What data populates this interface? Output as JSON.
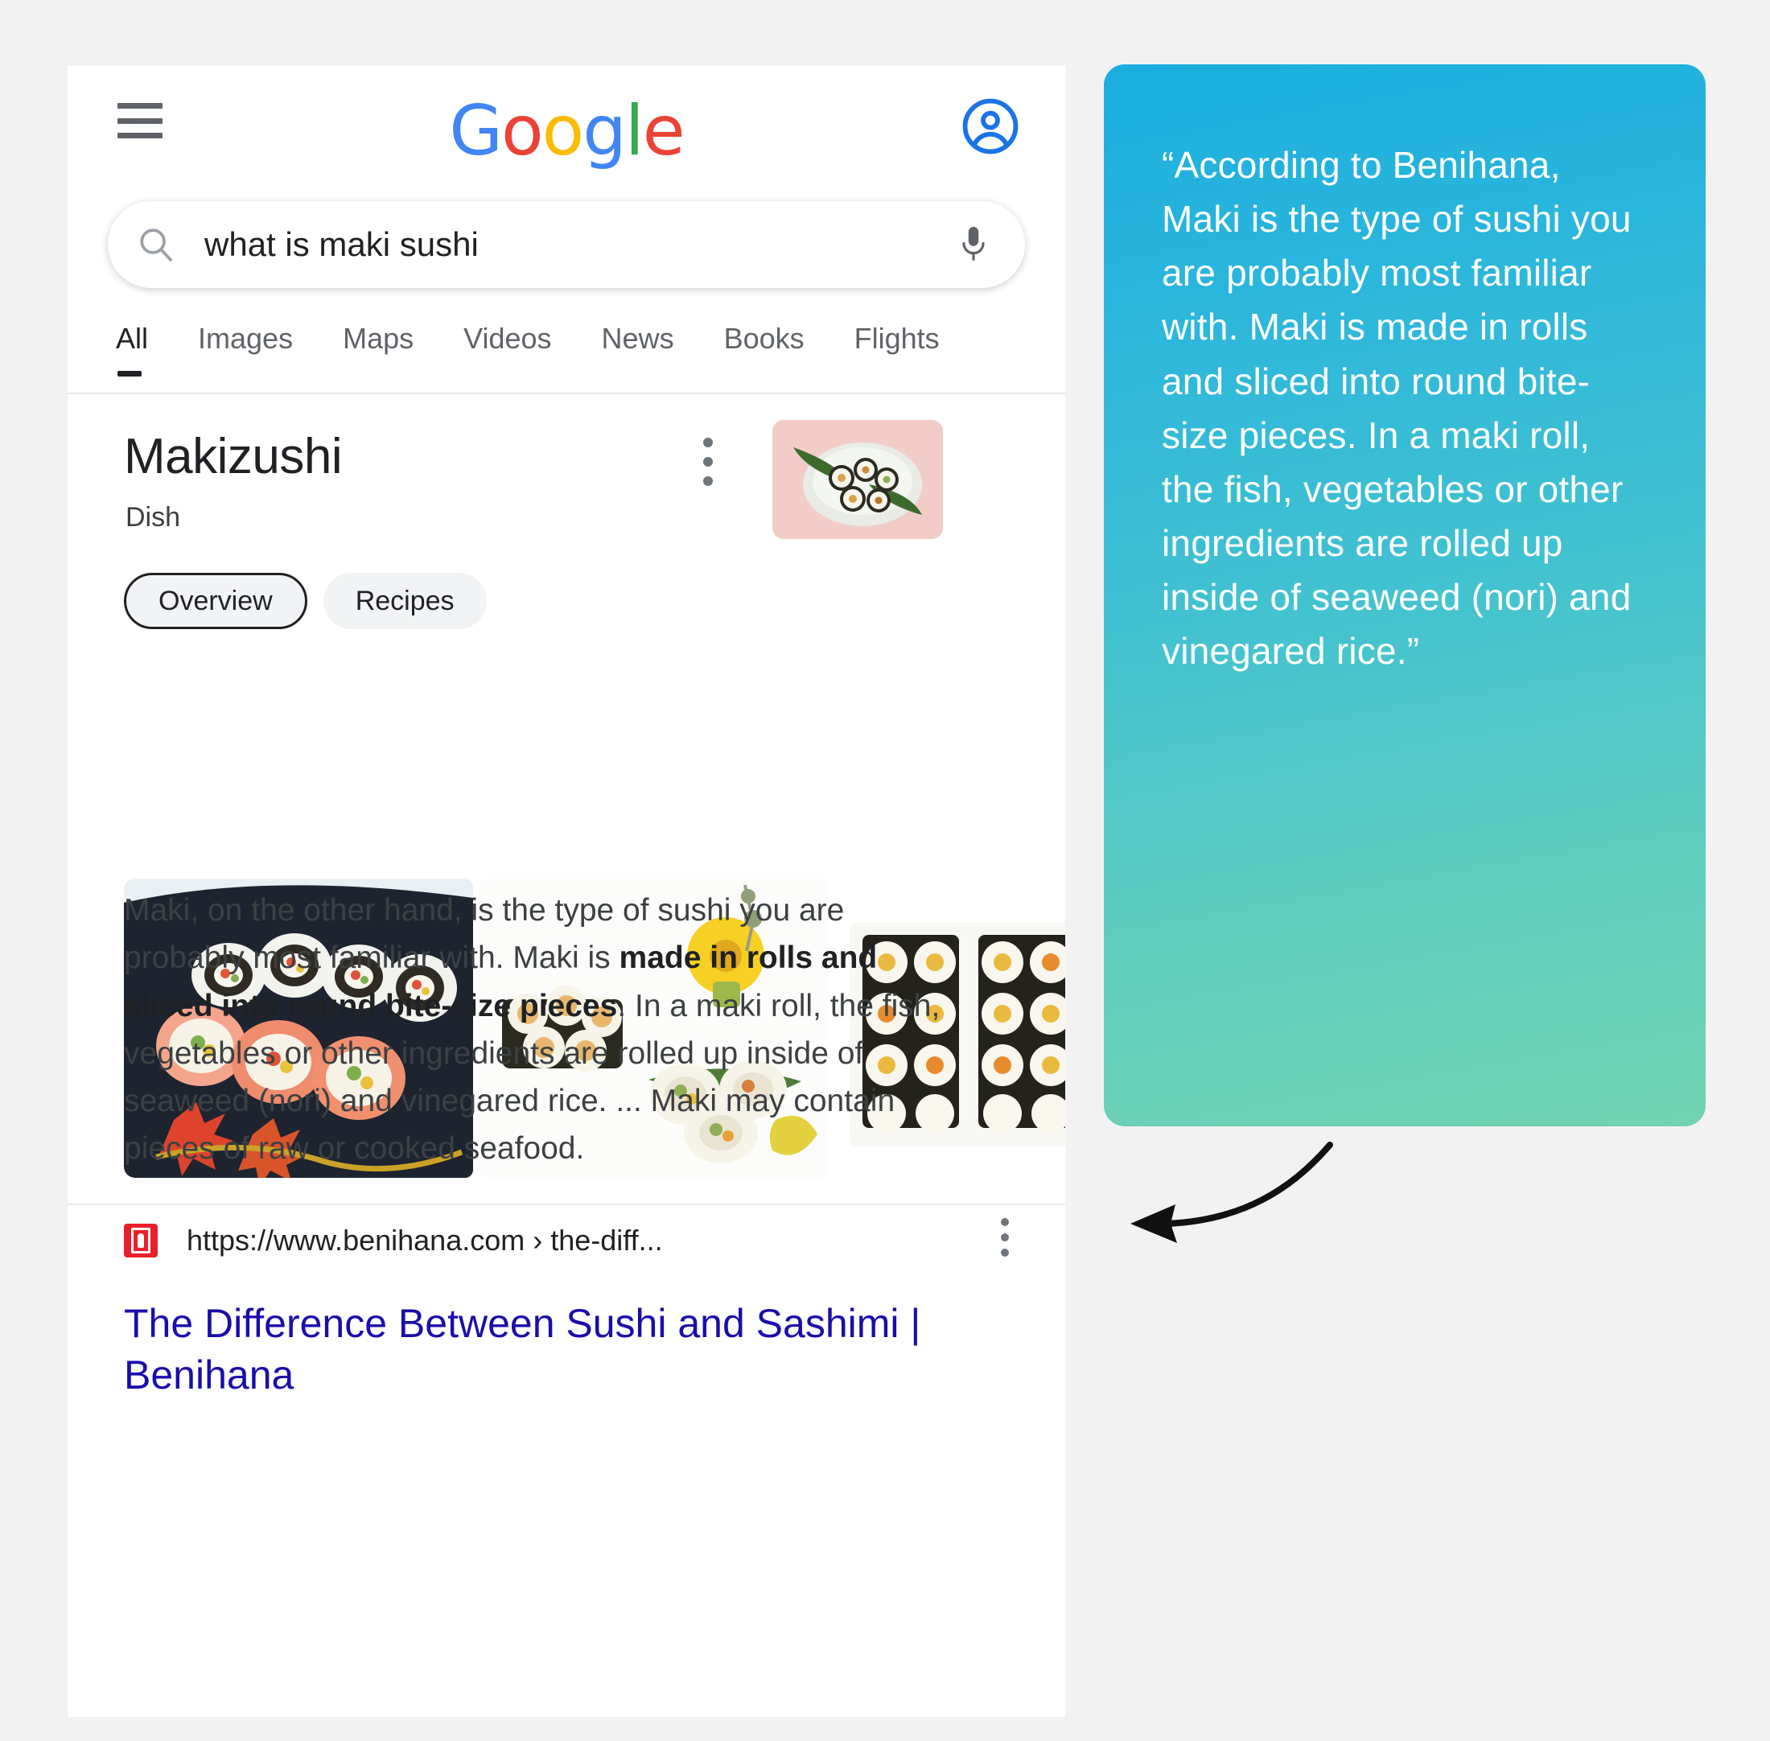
{
  "browser": {
    "header": {
      "menu_icon": "hamburger-menu-icon",
      "logo_letters": [
        "G",
        "o",
        "o",
        "g",
        "l",
        "e"
      ],
      "logo_text": "Google",
      "account_icon": "account-circle-icon"
    },
    "search": {
      "icon": "search-icon",
      "query": "what is maki sushi",
      "placeholder": "Search",
      "mic_icon": "microphone-icon"
    },
    "tabs": [
      {
        "label": "All",
        "active": true
      },
      {
        "label": "Images",
        "active": false
      },
      {
        "label": "Maps",
        "active": false
      },
      {
        "label": "Videos",
        "active": false
      },
      {
        "label": "News",
        "active": false
      },
      {
        "label": "Books",
        "active": false
      },
      {
        "label": "Flights",
        "active": false
      }
    ],
    "knowledge_panel": {
      "title": "Makizushi",
      "subtitle": "Dish",
      "overflow_icon": "more-vert-icon",
      "thumbnail_alt": "maki sushi rolls on a white plate with green leaf",
      "chips": [
        {
          "label": "Overview",
          "selected": true
        },
        {
          "label": "Recipes",
          "selected": false
        }
      ],
      "images": [
        {
          "alt": "assorted maki rolls on a black lacquer plate with maple leaves"
        },
        {
          "alt": "maki rolls on white background with yellow chrysanthemum garnish"
        },
        {
          "alt": "rows of maki rolls with yellow and orange fillings"
        }
      ]
    },
    "result": {
      "snippet_parts": [
        {
          "text": "Maki, on the other hand, is the type of sushi you are probably most familiar with. Maki is ",
          "bold": false
        },
        {
          "text": "made in rolls and sliced into round bite-size pieces",
          "bold": true
        },
        {
          "text": ". In a maki roll, the fish, vegetables or other ingredients are rolled up inside of seaweed (nori) and vinegared rice. ... Maki may contain pieces of raw or cooked seafood.",
          "bold": false
        }
      ],
      "favicon_name": "benihana-favicon",
      "url": "https://www.benihana.com › the-diff...",
      "overflow_icon": "more-vert-icon",
      "title": "The Difference Between Sushi and Sashimi | Benihana"
    }
  },
  "callout": {
    "quote": "“According to Benihana, Maki is the type of sushi you are probably most familiar with. Maki is made in rolls and sliced into round bite-size pieces. In a maki roll, the fish, vegetables or other ingredients are rolled up inside of seaweed (nori) and vinegared rice.”",
    "gradient_start": "#1aaede",
    "gradient_end": "#72d3b1",
    "text_color": "#ffffff"
  },
  "annotation": {
    "arrow_icon": "curved-arrow-left-icon",
    "arrow_color": "#111111"
  },
  "colors": {
    "page_background": "#f2f2f2",
    "card_background": "#ffffff",
    "link_blue": "#1a0dab",
    "text_primary": "#202124",
    "text_secondary": "#5f6368",
    "favicon_red": "#e8202a",
    "google_blue": "#4285F4",
    "google_red": "#EA4335",
    "google_yellow": "#FBBC05",
    "google_green": "#34A853"
  }
}
